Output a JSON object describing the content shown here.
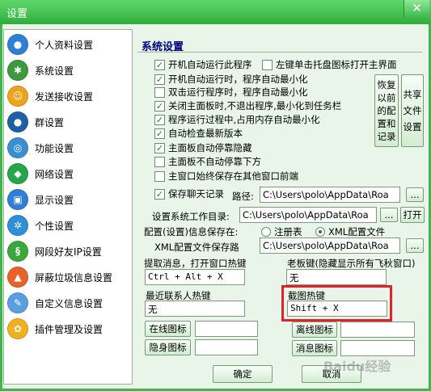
{
  "window": {
    "title": "设置",
    "close": "✕"
  },
  "sidebar": {
    "items": [
      {
        "label": "个人资料设置",
        "color": "#2f7fd8",
        "glyph": "●"
      },
      {
        "label": "系统设置",
        "color": "#3c9a3c",
        "glyph": "✱"
      },
      {
        "label": "发送接收设置",
        "color": "#f0a21b",
        "glyph": "☺"
      },
      {
        "label": "群设置",
        "color": "#1f5fa8",
        "glyph": "●"
      },
      {
        "label": "功能设置",
        "color": "#3a8fd0",
        "glyph": "◎"
      },
      {
        "label": "网络设置",
        "color": "#26a64a",
        "glyph": "◆"
      },
      {
        "label": "显示设置",
        "color": "#2f7fd8",
        "glyph": "▣"
      },
      {
        "label": "个性设置",
        "color": "#2f8fd8",
        "glyph": "✲"
      },
      {
        "label": "网段好友IP设置",
        "color": "#3aa83a",
        "glyph": "§"
      },
      {
        "label": "屏蔽垃圾信息设置",
        "color": "#e8622a",
        "glyph": "▲"
      },
      {
        "label": "自定义信息设置",
        "color": "#5aa0e0",
        "glyph": "✎"
      },
      {
        "label": "插件管理及设置",
        "color": "#f0b020",
        "glyph": "✿"
      }
    ]
  },
  "main": {
    "title": "系统设置",
    "options": [
      {
        "label": "开机自动运行此程序",
        "checked": true
      },
      {
        "label": "左键单击托盘图标打开主界面",
        "checked": false
      },
      {
        "label": "开机自动运行时，程序自动最小化",
        "checked": true
      },
      {
        "label": "双击运行程序时，程序自动最小化",
        "checked": false
      },
      {
        "label": "关闭主面板时,不退出程序,最小化到任务栏",
        "checked": true
      },
      {
        "label": "程序运行过程中,占用内存自动最小化",
        "checked": true
      },
      {
        "label": "自动检查最新版本",
        "checked": true
      },
      {
        "label": "主面板自动停靠隐藏",
        "checked": true
      },
      {
        "label": "主面板不自动停靠下方",
        "checked": false
      },
      {
        "label": "主窗口始终保存在其他窗口前端",
        "checked": false
      },
      {
        "label": "保存聊天记录",
        "checked": true
      }
    ],
    "restore_button": "恢复以前的配置和记录",
    "share_button": "共享文件设置",
    "path_label": "路径:",
    "path_value": "C:\\Users\\polo\\AppData\\Roa",
    "browse": "...",
    "workdir_label": "设置系统工作目录:",
    "workdir_value": "C:\\Users\\polo\\AppData\\Roa",
    "open_button": "打开",
    "config_label": "配置(设置)信息保存在:",
    "radio_registry": "注册表",
    "radio_xml": "XML配置文件",
    "xml_path_label": "XML配置文件保存路",
    "xml_path_value": "C:\\Users\\polo\\AppData\\Roa",
    "hotkey_fetch_label": "提取消息，打开窗口热键",
    "hotkey_fetch_value": "Ctrl + Alt + X",
    "hotkey_boss_label": "老板键(隐藏显示所有飞秋窗口)",
    "hotkey_boss_value": "无",
    "hotkey_recent_label": "最近联系人热键",
    "hotkey_recent_value": "无",
    "hotkey_screenshot_label": "截图热键",
    "hotkey_screenshot_value": "Shift + X",
    "online_icon": "在线图标",
    "offline_icon": "离线图标",
    "hidden_icon": "隐身图标",
    "message_icon": "消息图标",
    "ok": "确定",
    "cancel": "取消"
  },
  "watermark": "Baidu经验"
}
